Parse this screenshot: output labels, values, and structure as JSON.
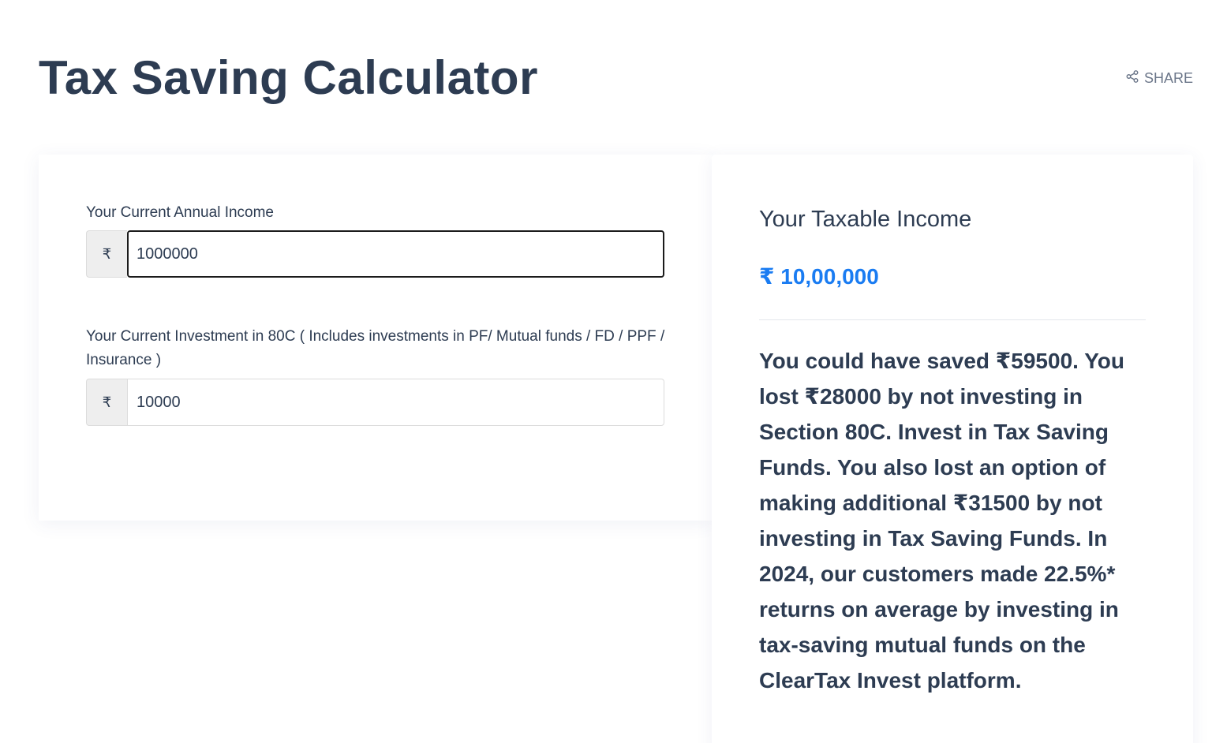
{
  "header": {
    "title": "Tax Saving Calculator",
    "share_label": "SHARE"
  },
  "inputs": {
    "currency_symbol": "₹",
    "income": {
      "label": "Your Current Annual Income",
      "value": "1000000"
    },
    "investment": {
      "label": "Your Current Investment in 80C ( Includes investments in PF/ Mutual funds / FD / PPF / Insurance )",
      "value": "10000"
    }
  },
  "result": {
    "label": "Your Taxable Income",
    "value": "₹ 10,00,000",
    "message": "You could have saved ₹59500. You lost ₹28000 by not investing in Section 80C. Invest in Tax Saving Funds. You also lost an option of making additional ₹31500 by not investing in Tax Saving Funds. In 2024, our customers made 22.5%* returns on average by investing in tax-saving mutual funds on the ClearTax Invest platform."
  },
  "colors": {
    "heading": "#2d3c52",
    "accent": "#1a7cf2",
    "muted": "#6b7689"
  }
}
